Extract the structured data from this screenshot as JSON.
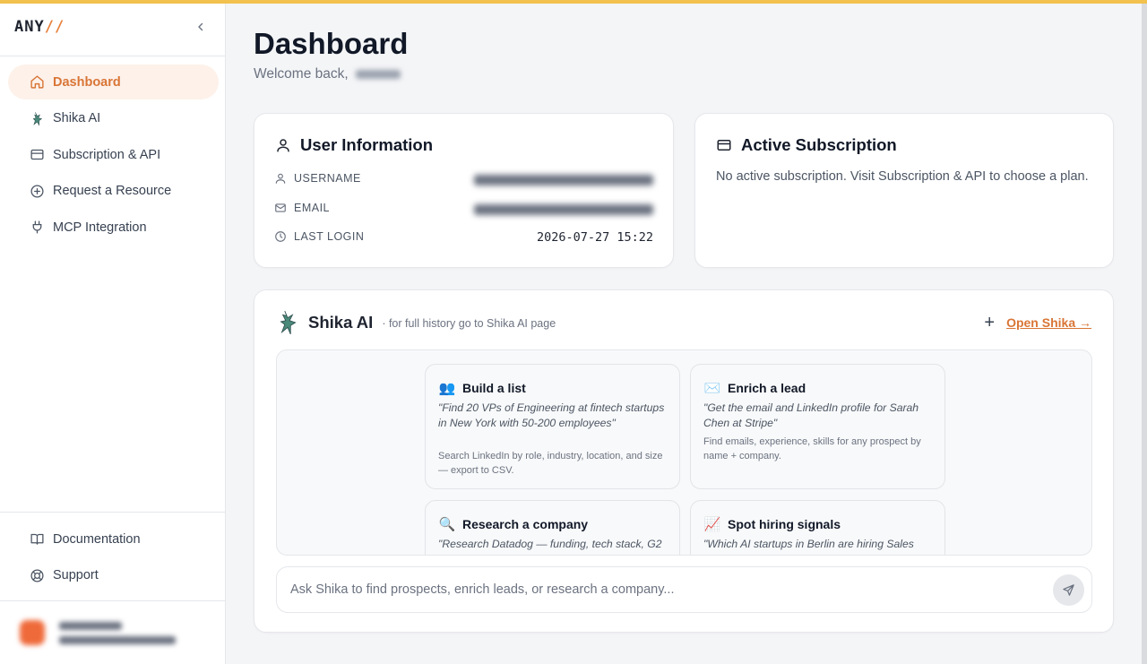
{
  "brand": {
    "logo_text": "ANY",
    "logo_mark": "//",
    "accent": "#e8823d",
    "topbar_color": "#f2c14e"
  },
  "sidebar": {
    "collapse_icon": "chevron-left-icon",
    "items": [
      {
        "label": "Dashboard",
        "icon": "home-icon",
        "active": true
      },
      {
        "label": "Shika AI",
        "icon": "shika-logo-icon",
        "active": false
      },
      {
        "label": "Subscription & API",
        "icon": "credit-card-icon",
        "active": false
      },
      {
        "label": "Request a Resource",
        "icon": "plus-circle-icon",
        "active": false
      },
      {
        "label": "MCP Integration",
        "icon": "plug-icon",
        "active": false
      }
    ],
    "bottom_items": [
      {
        "label": "Documentation",
        "icon": "book-icon"
      },
      {
        "label": "Support",
        "icon": "lifebuoy-icon"
      }
    ]
  },
  "header": {
    "title": "Dashboard",
    "welcome": "Welcome back,"
  },
  "user_info": {
    "title": "User Information",
    "rows": [
      {
        "label": "USERNAME",
        "icon": "user-icon"
      },
      {
        "label": "EMAIL",
        "icon": "mail-icon"
      },
      {
        "label": "LAST LOGIN",
        "icon": "clock-icon",
        "value": "2026-07-27 15:22"
      }
    ]
  },
  "subscription": {
    "title": "Active Subscription",
    "text": "No active subscription. Visit Subscription & API to choose a plan."
  },
  "shika": {
    "title": "Shika AI",
    "subtitle": "· for full history go to Shika AI page",
    "open_label": "Open Shika →",
    "new_chat_label": "+",
    "suggestions": [
      {
        "emoji": "👥",
        "title": "Build a list",
        "quote": "\"Find 20 VPs of Engineering at fintech startups in New York with 50-200 employees\"",
        "desc": "Search LinkedIn by role, industry, location, and size — export to CSV."
      },
      {
        "emoji": "✉️",
        "title": "Enrich a lead",
        "quote": "\"Get the email and LinkedIn profile for Sarah Chen at Stripe\"",
        "desc": "Find emails, experience, skills for any prospect by name + company."
      },
      {
        "emoji": "🔍",
        "title": "Research a company",
        "quote": "\"Research Datadog — funding, tech stack, G2",
        "desc": ""
      },
      {
        "emoji": "📈",
        "title": "Spot hiring signals",
        "quote": "\"Which AI startups in Berlin are hiring Sales",
        "desc": ""
      }
    ],
    "input_placeholder": "Ask Shika to find prospects, enrich leads, or research a company..."
  }
}
